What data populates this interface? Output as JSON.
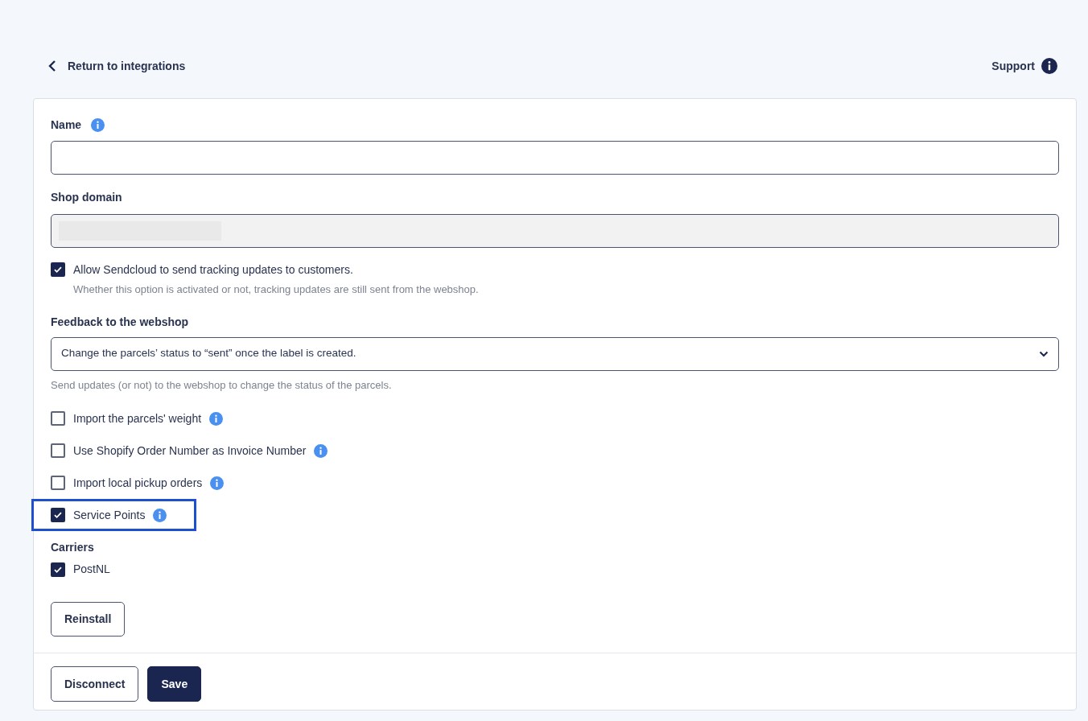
{
  "header": {
    "back_link": "Return to integrations",
    "support_link": "Support"
  },
  "form": {
    "name_field": {
      "label": "Name"
    },
    "shop_domain_field": {
      "label": "Shop domain",
      "disabled": true,
      "value_redacted": true
    },
    "tracking_option": {
      "label": "Allow Sendcloud to send tracking updates to customers.",
      "help": "Whether this option is activated or not, tracking updates are still sent from the webshop.",
      "checked": true
    },
    "feedback": {
      "label": "Feedback to the webshop",
      "value": "Change the parcels’ status to “sent” once the label is created.",
      "help": "Send updates (or not) to the webshop to change the status of the parcels."
    },
    "options": [
      {
        "label": "Import the parcels' weight",
        "checked": false,
        "highlighted": false
      },
      {
        "label": "Use Shopify Order Number as Invoice Number",
        "checked": false,
        "highlighted": false
      },
      {
        "label": "Import local pickup orders",
        "checked": false,
        "highlighted": false
      },
      {
        "label": "Service Points",
        "checked": true,
        "highlighted": true
      }
    ],
    "carriers": {
      "label": "Carriers",
      "items": [
        {
          "label": "PostNL",
          "checked": true
        }
      ]
    },
    "reinstall_button": "Reinstall"
  },
  "footer": {
    "buttons": [
      {
        "label": "Disconnect",
        "kind": "secondary"
      },
      {
        "label": "Save",
        "kind": "primary"
      }
    ]
  }
}
